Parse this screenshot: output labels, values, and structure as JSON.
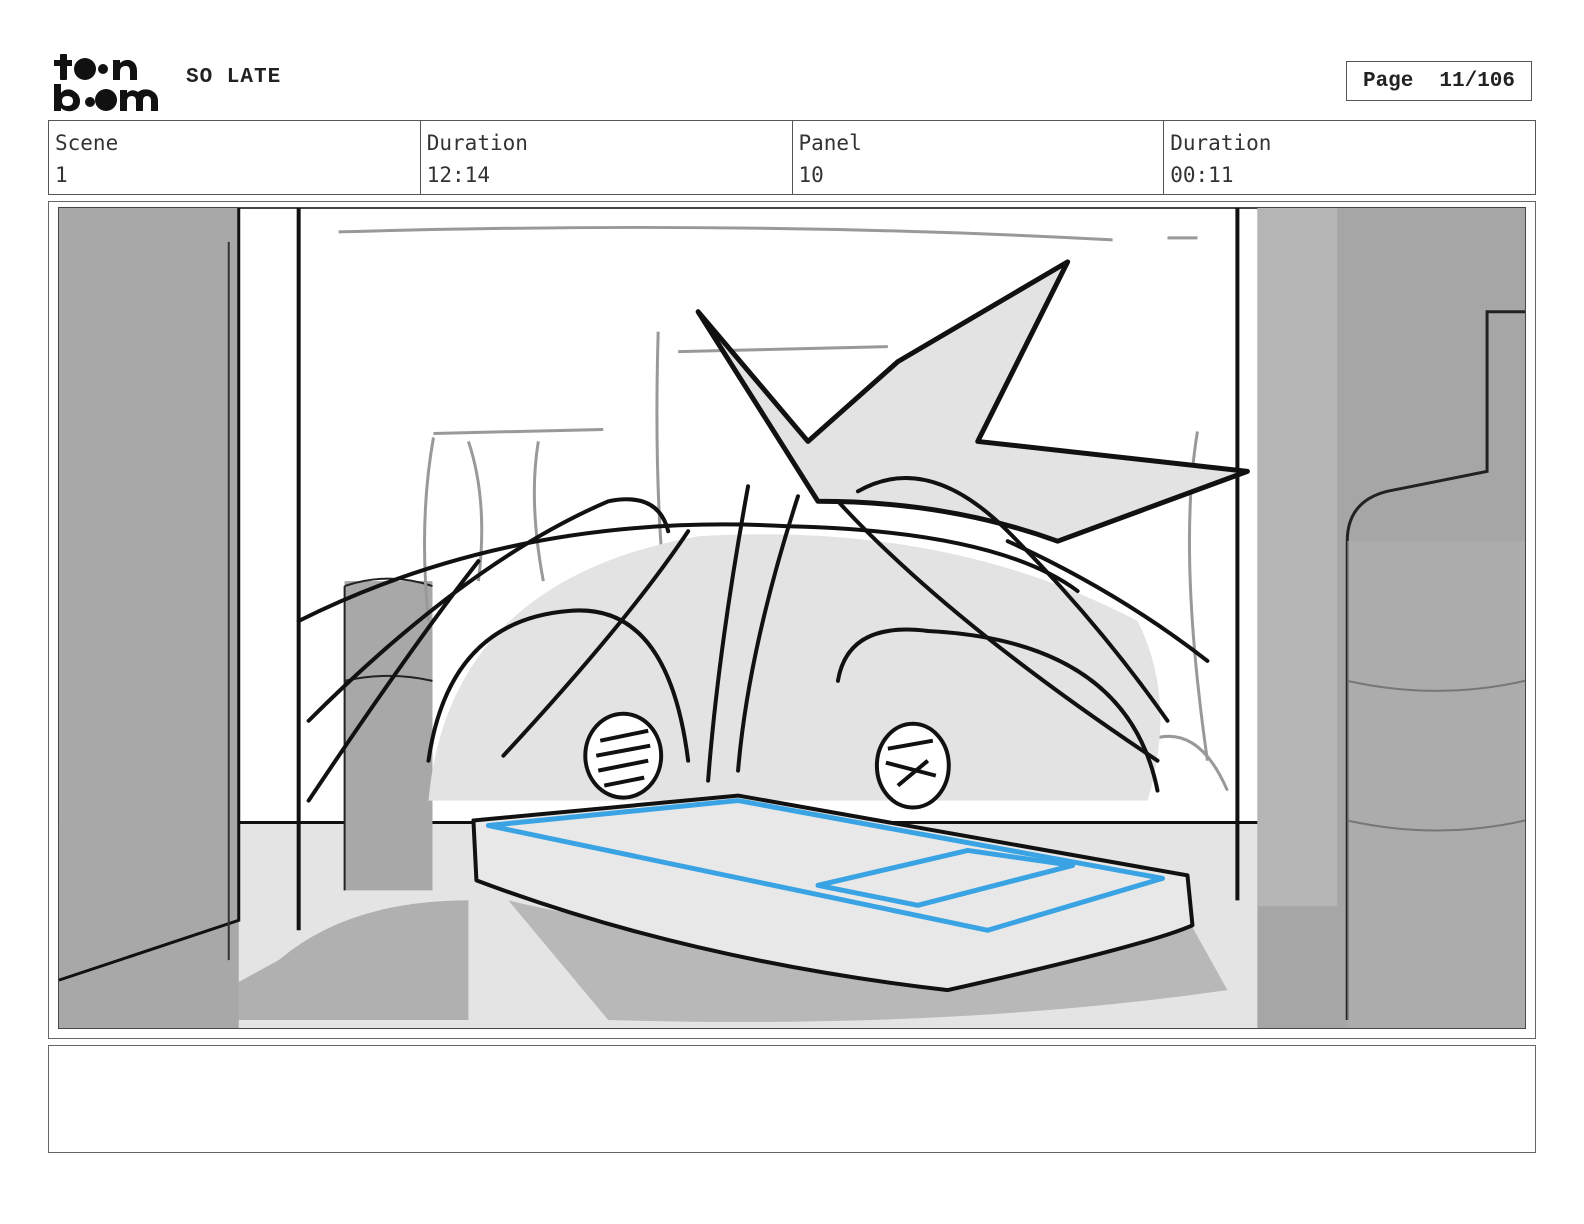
{
  "header": {
    "logo_text": "toon boom",
    "project_title": "SO LATE",
    "page_label": "Page",
    "page_number": "11/106"
  },
  "info": {
    "scene_label": "Scene",
    "scene_value": "1",
    "scene_duration_label": "Duration",
    "scene_duration_value": "12:14",
    "panel_label": "Panel",
    "panel_value": "10",
    "panel_duration_label": "Duration",
    "panel_duration_value": "00:11"
  },
  "colors": {
    "sketch_line": "#111111",
    "sketch_gray": "#a6a6a6",
    "sketch_light": "#e6e6e6",
    "phone_outline": "#3aa3e3"
  }
}
